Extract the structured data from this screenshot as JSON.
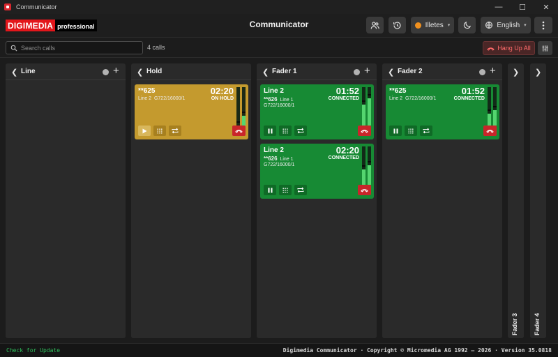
{
  "window": {
    "title": "Communicator",
    "minimize": "—",
    "maximize": "☐",
    "close": "✕"
  },
  "header": {
    "logo_main": "DIGIMEDIA",
    "logo_sub": "professional",
    "title": "Communicator",
    "status_label": "Illetes",
    "status_color": "#f0901e",
    "language": "English"
  },
  "search": {
    "placeholder": "Search calls",
    "value": "",
    "count": "4 calls"
  },
  "toolbar": {
    "hangup_all": "Hang Up All"
  },
  "columns": [
    {
      "name": "Line"
    },
    {
      "name": "Hold"
    },
    {
      "name": "Fader 1"
    },
    {
      "name": "Fader 2"
    }
  ],
  "collapsed_columns": [
    {
      "name": "Fader 3"
    },
    {
      "name": "Fader 4"
    }
  ],
  "calls": [
    {
      "title": "**625",
      "number": "",
      "line": "Line 2",
      "codec": "G722/16000/1",
      "time": "02:20",
      "state": "ON HOLD",
      "levels": [
        0.0,
        0.25
      ]
    },
    {
      "title": "Line 2",
      "number": "**626",
      "line": "Line 1",
      "codec": "G722/16000/1",
      "time": "01:52",
      "state": "CONNECTED",
      "levels": [
        0.55,
        0.7
      ]
    },
    {
      "title": "Line 2",
      "number": "**626",
      "line": "Line 1",
      "codec": "G722/16000/1",
      "time": "02:20",
      "state": "CONNECTED",
      "levels": [
        0.4,
        0.5
      ]
    },
    {
      "title": "**625",
      "number": "",
      "line": "Line 2",
      "codec": "G722/16000/1",
      "time": "01:52",
      "state": "CONNECTED",
      "levels": [
        0.3,
        0.4
      ]
    }
  ],
  "footer": {
    "update": "Check for Update",
    "copyright": "Digimedia Communicator · Copyright © Micromedia AG 1992 – 2026 · Version 35.0818"
  },
  "colors": {
    "accent_red": "#e3161b",
    "hold": "#c49a2e",
    "connected": "#178a34",
    "hangup": "#c9262a"
  }
}
